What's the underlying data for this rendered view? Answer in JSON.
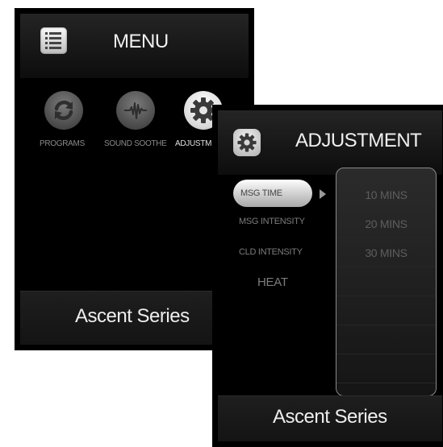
{
  "menu_screen": {
    "title": "MENU",
    "tiles": [
      {
        "label": "PROGRAMS",
        "icon": "refresh-icon"
      },
      {
        "label": "SOUND SOOTHE",
        "icon": "sound-wave-icon"
      },
      {
        "label": "ADJUSTM",
        "icon": "gear-icon"
      }
    ],
    "footer": "Ascent Series"
  },
  "adjust_screen": {
    "title": "ADJUSTMENT",
    "options": [
      {
        "label": "MSG TIME",
        "selected": true
      },
      {
        "label": "MSG INTENSITY"
      },
      {
        "label": "CLD INTENSITY"
      },
      {
        "label": "HEAT"
      }
    ],
    "time_values": [
      "10 MINS",
      "20 MINS",
      "30 MINS"
    ],
    "footer": "Ascent Series"
  },
  "colors": {
    "background": "#000000",
    "text_light": "#f0f0f0",
    "text_dim": "#7c7c7c",
    "selected_pill": "#d8d8d8"
  }
}
